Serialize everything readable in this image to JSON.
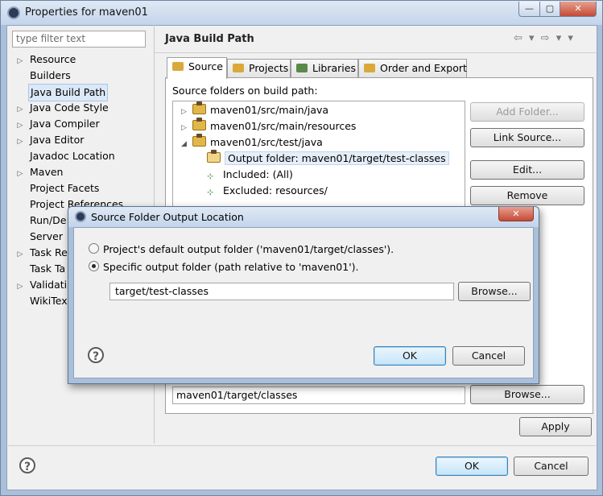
{
  "window": {
    "title": "Properties for maven01",
    "controls": {
      "minimize": "—",
      "maximize": "▢",
      "close": "✕"
    }
  },
  "sidebar": {
    "filter_placeholder": "type filter text",
    "items": [
      {
        "label": "Resource",
        "expandable": true
      },
      {
        "label": "Builders",
        "expandable": false
      },
      {
        "label": "Java Build Path",
        "expandable": false,
        "selected": true
      },
      {
        "label": "Java Code Style",
        "expandable": true
      },
      {
        "label": "Java Compiler",
        "expandable": true
      },
      {
        "label": "Java Editor",
        "expandable": true
      },
      {
        "label": "Javadoc Location",
        "expandable": false
      },
      {
        "label": "Maven",
        "expandable": true
      },
      {
        "label": "Project Facets",
        "expandable": false
      },
      {
        "label": "Project References",
        "expandable": false
      },
      {
        "label": "Run/De",
        "expandable": false
      },
      {
        "label": "Server",
        "expandable": false
      },
      {
        "label": "Task Re",
        "expandable": true
      },
      {
        "label": "Task Ta",
        "expandable": false
      },
      {
        "label": "Validati",
        "expandable": true
      },
      {
        "label": "WikiTex",
        "expandable": false
      }
    ]
  },
  "page": {
    "title": "Java Build Path",
    "nav": "⇦ ▾ ⇨ ▾ ▾",
    "tabs": [
      {
        "label": "Source",
        "active": true,
        "icon_color": "#d9a93a"
      },
      {
        "label": "Projects",
        "active": false,
        "icon_color": "#d9a93a"
      },
      {
        "label": "Libraries",
        "active": false,
        "icon_color": "#5a8a4a"
      },
      {
        "label": "Order and Export",
        "active": false,
        "icon_color": "#d9a93a"
      }
    ],
    "source_label": "Source folders on build path:",
    "tree": [
      {
        "label": "maven01/src/main/java",
        "level": 0,
        "arrow": "▷",
        "type": "folder"
      },
      {
        "label": "maven01/src/main/resources",
        "level": 0,
        "arrow": "▷",
        "type": "folder"
      },
      {
        "label": "maven01/src/test/java",
        "level": 0,
        "arrow": "◢",
        "type": "folder"
      },
      {
        "label": "Output folder: maven01/target/test-classes",
        "level": 1,
        "type": "output",
        "selected": true
      },
      {
        "label": "Included: (All)",
        "level": 1,
        "type": "filter"
      },
      {
        "label": "Excluded: resources/",
        "level": 1,
        "type": "filter"
      }
    ],
    "buttons": {
      "add_folder": "Add Folder...",
      "link_source": "Link Source...",
      "edit": "Edit...",
      "remove": "Remove",
      "browse": "Browse...",
      "apply": "Apply"
    },
    "default_output": "maven01/target/classes"
  },
  "footer": {
    "help": "?",
    "ok": "OK",
    "cancel": "Cancel"
  },
  "dialog": {
    "title": "Source Folder Output Location",
    "close": "✕",
    "options": [
      {
        "label": "Project's default output folder ('maven01/target/classes').",
        "selected": false
      },
      {
        "label": "Specific output folder (path relative to 'maven01').",
        "selected": true
      }
    ],
    "path_value": "target/test-classes",
    "browse": "Browse...",
    "help": "?",
    "ok": "OK",
    "cancel": "Cancel"
  }
}
